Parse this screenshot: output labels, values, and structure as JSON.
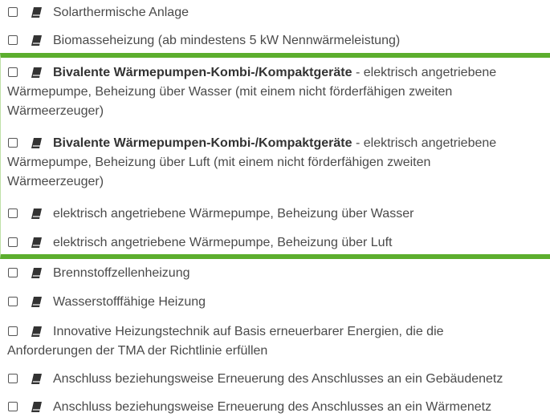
{
  "items": [
    {
      "label": "Solarthermische Anlage"
    },
    {
      "label": "Biomasseheizung (ab mindestens 5 kW Nennwärmeleistung)"
    },
    {
      "bold": "Bivalente Wärmepumpen-Kombi-/Kompaktgeräte",
      "rest": " - elektrisch angetriebene",
      "line2": "Wärmepumpe, Beheizung über Wasser (mit einem nicht förderfähigen zweiten",
      "line3": "Wärmeerzeuger)"
    },
    {
      "bold": "Bivalente Wärmepumpen-Kombi-/Kompaktgeräte",
      "rest": " - elektrisch angetriebene",
      "line2": "Wärmepumpe, Beheizung über Luft (mit einem nicht förderfähigen zweiten",
      "line3": "Wärmeerzeuger)"
    },
    {
      "label": "elektrisch angetriebene Wärmepumpe, Beheizung über Wasser"
    },
    {
      "label": "elektrisch angetriebene Wärmepumpe, Beheizung über Luft"
    },
    {
      "label": "Brennstoffzellenheizung"
    },
    {
      "label": "Wasserstofffähige Heizung"
    },
    {
      "label": "Innovative Heizungstechnik auf Basis erneuerbarer Energien, die die",
      "line2": "Anforderungen der TMA der Richtlinie erfüllen"
    },
    {
      "label": "Anschluss beziehungsweise Erneuerung des Anschlusses an ein Gebäudenetz"
    },
    {
      "label": "Anschluss beziehungsweise Erneuerung des Anschlusses an ein Wärmenetz"
    }
  ],
  "colors": {
    "highlight_border": "#5cae2e",
    "text": "#4a4a4a"
  },
  "icons": {
    "info": "book-icon"
  }
}
